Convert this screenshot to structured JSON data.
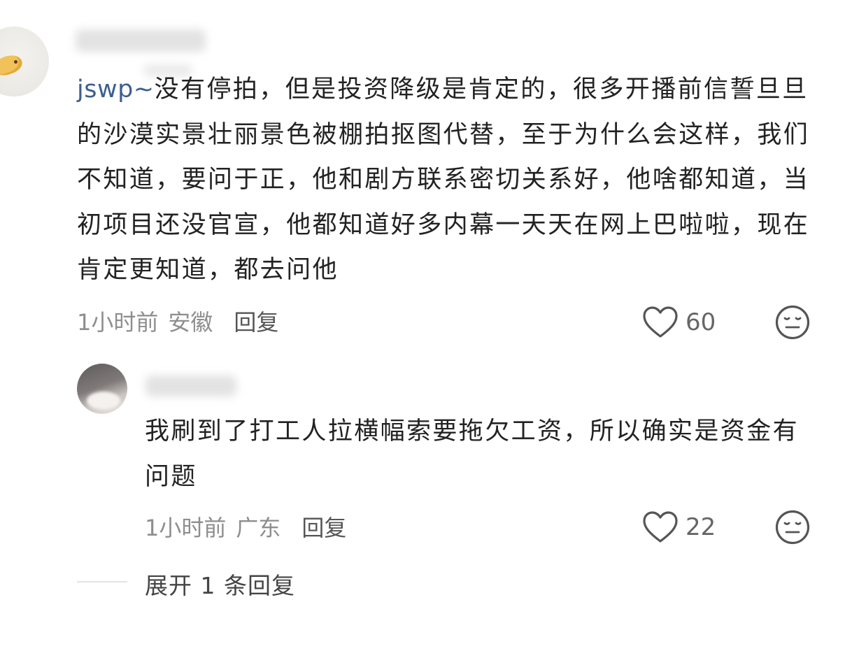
{
  "comment": {
    "mention": "jswp~",
    "text": "没有停拍，但是投资降级是肯定的，很多开播前信誓旦旦的沙漠实景壮丽景色被棚拍抠图代替，至于为什么会这样，我们不知道，要问于正，他和剧方联系密切关系好，他啥都知道，当初项目还没官宣，他都知道好多内幕一天天在网上巴啦啦，现在肯定更知道，都去问他",
    "time": "1小时前",
    "location": "安徽",
    "reply_label": "回复",
    "likes": "60",
    "like_icon": "heart-outline-icon",
    "reaction_icon": "meh-face-icon"
  },
  "reply": {
    "text": "我刷到了打工人拉横幅索要拖欠工资，所以确实是资金有问题",
    "time": "1小时前",
    "location": "广东",
    "reply_label": "回复",
    "likes": "22",
    "like_icon": "heart-outline-icon",
    "reaction_icon": "meh-face-icon"
  },
  "expand": {
    "label": "展开 1 条回复"
  },
  "colors": {
    "text": "#222222",
    "meta": "#8e8e8e",
    "mention": "#3d5f8f",
    "icon": "#555555"
  }
}
